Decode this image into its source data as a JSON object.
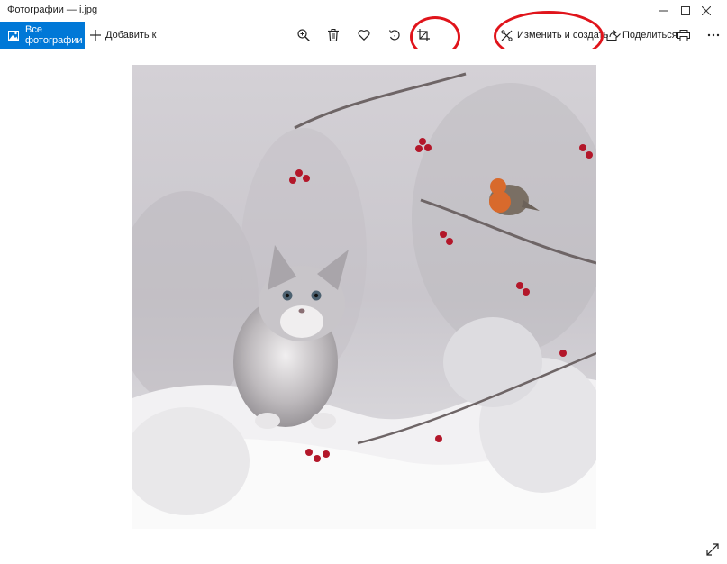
{
  "window": {
    "title": "Фотографии — i.jpg",
    "minimize_icon": "minimize-icon",
    "maximize_icon": "maximize-icon",
    "close_icon": "close-icon"
  },
  "toolbar": {
    "all_photos_label": "Все фотографии",
    "all_photos_icon": "photo-gallery-icon",
    "add_label": "Добавить к",
    "add_icon": "plus-icon",
    "zoom_icon": "zoom-in-icon",
    "delete_icon": "trash-icon",
    "favorite_icon": "heart-icon",
    "rotate_icon": "rotate-icon",
    "crop_icon": "crop-icon",
    "edit_create_label": "Изменить и создать",
    "edit_create_icon": "edit-create-icon",
    "share_label": "Поделиться",
    "share_icon": "share-icon",
    "print_icon": "print-icon",
    "more_icon": "more-icon"
  },
  "viewer": {
    "image_description_icon": "photo-kitten-robin-winter",
    "fullscreen_icon": "expand-fullscreen-icon"
  },
  "colors": {
    "accent": "#0078d7",
    "annotation": "#e0141b"
  }
}
